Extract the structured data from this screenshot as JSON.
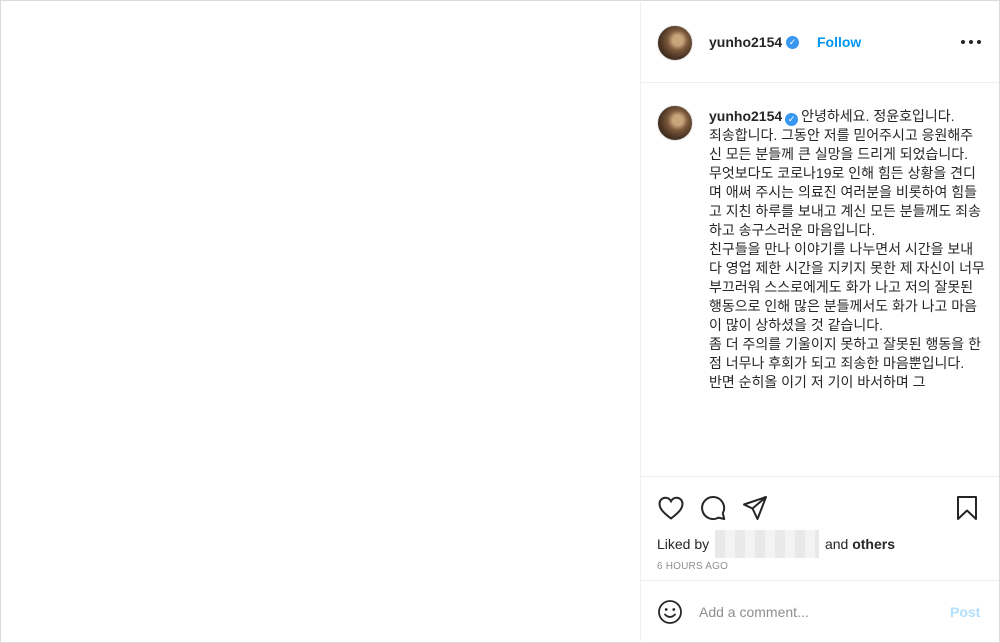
{
  "post": {
    "username": "yunho2154",
    "verified_glyph": "✓",
    "follow_label": "Follow",
    "separator": "•",
    "more_icon": "more-horizontal-icon"
  },
  "caption": {
    "username": "yunho2154",
    "text": "안녕하세요. 정윤호입니다.\n죄송합니다. 그동안 저를 믿어주시고 응원해주신 모든 분들께 큰 실망을 드리게 되었습니다.\n무엇보다도 코로나19로 인해 힘든 상황을 견디며 애써 주시는 의료진 여러분을 비롯하여 힘들고 지친 하루를 보내고 계신 모든 분들께도 죄송하고 송구스러운 마음입니다.\n친구들을 만나 이야기를 나누면서 시간을 보내다 영업 제한 시간을 지키지 못한 제 자신이 너무 부끄러워 스스로에게도 화가 나고 저의 잘못된 행동으로 인해 많은 분들께서도 화가 나고 마음이 많이 상하셨을 것 같습니다.\n좀 더 주의를 기울이지 못하고 잘못된 행동을 한 점 너무나 후회가 되고 죄송한 마음뿐입니다.\n반면 순히올 이기 저 기이 바서하며 그"
  },
  "actions": {
    "liked_by_prefix": "Liked by",
    "liked_by_middle": "and",
    "liked_by_others": "others",
    "timestamp": "6 HOURS AGO"
  },
  "add_comment": {
    "placeholder": "Add a comment...",
    "post_label": "Post"
  },
  "colors": {
    "accent": "#0095f6",
    "verified": "#3897f0",
    "post_disabled": "#b2dffc",
    "muted": "#8e8e8e"
  }
}
